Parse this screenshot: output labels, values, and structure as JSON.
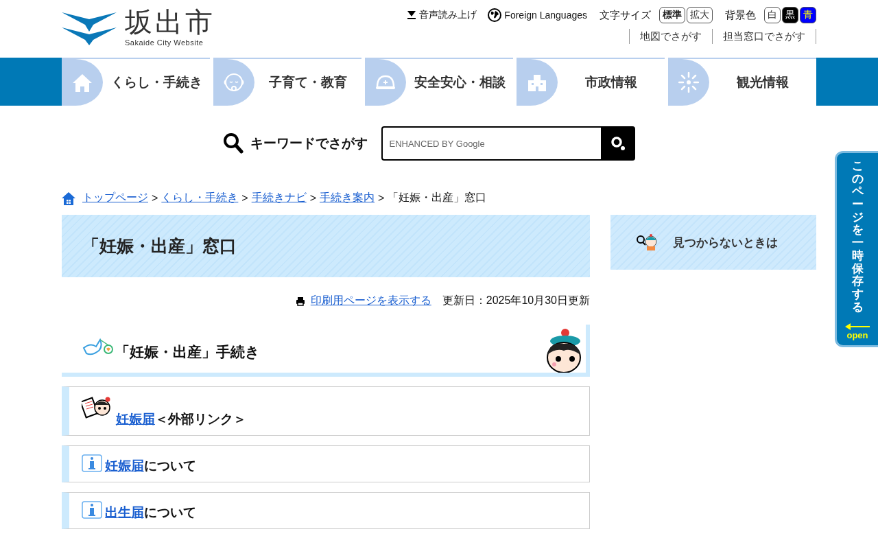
{
  "header": {
    "logo": {
      "name": "坂出市",
      "subtitle": "Sakaide City Website"
    },
    "read_aloud": "音声読み上げ",
    "foreign_languages": "Foreign Languages",
    "text_size": {
      "label": "文字サイズ",
      "options": [
        {
          "label": "標準",
          "selected": true
        },
        {
          "label": "拡大",
          "selected": false
        }
      ]
    },
    "background": {
      "label": "背景色",
      "options": [
        {
          "label": "白",
          "color": "#ffffff",
          "kind": "light"
        },
        {
          "label": "黒",
          "color": "#000000",
          "kind": "dark"
        },
        {
          "label": "青",
          "color": "#0000ff",
          "kind": "vivid"
        }
      ]
    },
    "links": [
      "地図でさがす",
      "担当窓口でさがす"
    ]
  },
  "nav": [
    {
      "label": "くらし・手続き",
      "kind": "house"
    },
    {
      "label": "子育て・教育",
      "kind": "baby"
    },
    {
      "label": "安全安心・相談",
      "kind": "helmet"
    },
    {
      "label": "市政情報",
      "kind": "building"
    },
    {
      "label": "観光情報",
      "kind": "firework"
    }
  ],
  "search": {
    "label": "キーワードでさがす",
    "placeholder": "ENHANCED BY Google"
  },
  "breadcrumb": {
    "separator": ">",
    "items": [
      {
        "label": "トップページ",
        "link": true
      },
      {
        "label": "くらし・手続き",
        "link": true
      },
      {
        "label": "手続きナビ",
        "link": true
      },
      {
        "label": "手続き案内",
        "link": true
      },
      {
        "label": "「妊娠・出産」窓口",
        "link": false
      }
    ]
  },
  "page_title": "「妊娠・出産」窓口",
  "print_link": "印刷用ページを表示する",
  "updated": "更新日：2025年10月30日更新",
  "section": {
    "heading": "「妊娠・出産」手続き"
  },
  "items": [
    {
      "kind": "external",
      "link": "妊娠届",
      "text": "＜外部リンク＞"
    },
    {
      "kind": "info",
      "link": "妊娠届",
      "text": "について"
    },
    {
      "kind": "info",
      "link": "出生届",
      "text": "について"
    }
  ],
  "sidebar": {
    "help_button": "見つからないときは"
  },
  "save_tab": {
    "label": "このページを一時保存する",
    "action": "open"
  }
}
